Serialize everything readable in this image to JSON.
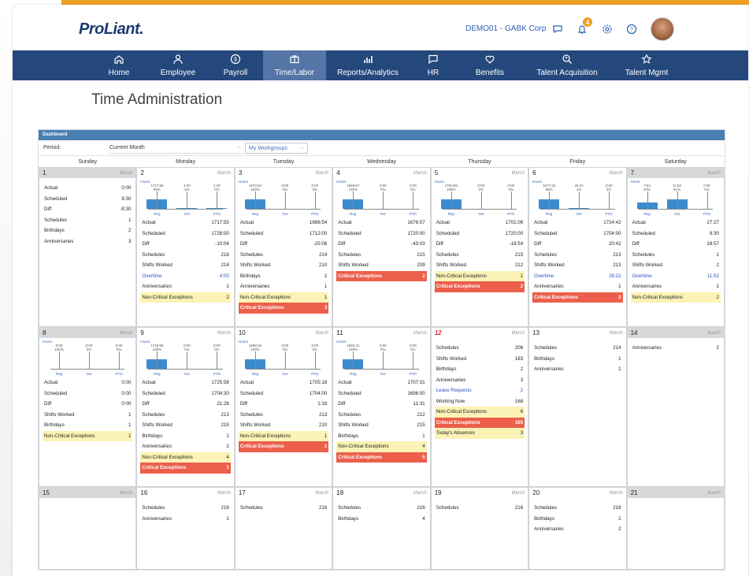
{
  "app": {
    "logo": "ProLiant.",
    "company": "DEMO01 - GABK Corp",
    "notification_count": "4"
  },
  "nav": [
    {
      "label": "Home",
      "icon": "home-icon"
    },
    {
      "label": "Employee",
      "icon": "person-icon"
    },
    {
      "label": "Payroll",
      "icon": "dollar-icon"
    },
    {
      "label": "Time/Labor",
      "icon": "briefcase-icon",
      "active": true
    },
    {
      "label": "Reports/Analytics",
      "icon": "bar-chart-icon"
    },
    {
      "label": "HR",
      "icon": "chat-icon"
    },
    {
      "label": "Benefits",
      "icon": "heart-icon"
    },
    {
      "label": "Talent Acquisition",
      "icon": "search-person-icon"
    },
    {
      "label": "Talent Mgmt",
      "icon": "star-icon"
    }
  ],
  "page": {
    "title": "Time Administration"
  },
  "dashboard": {
    "header": "Dashboard",
    "period_label": "Period:",
    "period_value": "Current Month",
    "workgroups_label": "My Workgroups",
    "days": [
      "Sunday",
      "Monday",
      "Tuesday",
      "Wednesday",
      "Thursday",
      "Friday",
      "Saturday"
    ],
    "chart_labels": {
      "title": "Hours",
      "reg": "Reg",
      "ovt": "Ovt",
      "pto": "PTO"
    }
  },
  "cells": [
    {
      "day": "1",
      "month": "March",
      "weekend": true,
      "rows": [
        [
          "Actual",
          "0:00"
        ],
        [
          "Scheduled",
          "8:30"
        ],
        [
          "Diff",
          "-8:30"
        ],
        [
          "Schedules",
          "1"
        ],
        [
          "Birthdays",
          "2"
        ],
        [
          "Anniversaries",
          "3"
        ]
      ]
    },
    {
      "day": "2",
      "month": "March",
      "chart": {
        "reg": 1717.55,
        "ovt": 4.0,
        "pto": 1.3,
        "reg_label": "1717:55\n99%",
        "ovt_label": "4:00\n0%",
        "pto_label": "1:30\n0%"
      },
      "rows": [
        [
          "Actual",
          "1717:55"
        ],
        [
          "Scheduled",
          "1728:00"
        ],
        [
          "Diff",
          "-10:04"
        ],
        [
          "Schedules",
          "216"
        ],
        [
          "Shifts Worked",
          "214"
        ],
        [
          "Overtime",
          "4:00",
          "ot"
        ],
        [
          "Anniversaries",
          "1"
        ],
        [
          "Non-Critical Exceptions",
          "2",
          "noncrit"
        ]
      ]
    },
    {
      "day": "3",
      "month": "March",
      "chart": {
        "reg": 1686.54,
        "ovt": 0,
        "pto": 0,
        "reg_label": "1673:54\n100%",
        "ovt_label": "0:00\n0%",
        "pto_label": "0:00\n0%"
      },
      "rows": [
        [
          "Actual",
          "1686:54"
        ],
        [
          "Scheduled",
          "1712:00"
        ],
        [
          "Diff",
          "-25:06"
        ],
        [
          "Schedules",
          "214"
        ],
        [
          "Shifts Worked",
          "210"
        ],
        [
          "Birthdays",
          "2"
        ],
        [
          "Anniversaries",
          "1"
        ],
        [
          "Non-Critical Exceptions",
          "1",
          "noncrit"
        ],
        [
          "Critical Exceptions",
          "3",
          "crit"
        ]
      ]
    },
    {
      "day": "4",
      "month": "March",
      "chart": {
        "reg": 1676.57,
        "ovt": 0,
        "pto": 0,
        "reg_label": "1669:57\n100%",
        "ovt_label": "0:00\n0%",
        "pto_label": "0:00\n0%"
      },
      "rows": [
        [
          "Actual",
          "1676:57"
        ],
        [
          "Scheduled",
          "1720:00"
        ],
        [
          "Diff",
          "-43:03"
        ],
        [
          "Schedules",
          "215"
        ],
        [
          "Shifts Worked",
          "209"
        ],
        [
          "Critical Exceptions",
          "2",
          "crit"
        ]
      ]
    },
    {
      "day": "5",
      "month": "March",
      "chart": {
        "reg": 1701.06,
        "ovt": 0,
        "pto": 0,
        "reg_label": "1700:06\n100%",
        "ovt_label": "0:00\n0%",
        "pto_label": "0:00\n0%"
      },
      "rows": [
        [
          "Actual",
          "1701:06"
        ],
        [
          "Scheduled",
          "1720:00"
        ],
        [
          "Diff",
          "-18:54"
        ],
        [
          "Schedules",
          "215"
        ],
        [
          "Shifts Worked",
          "212"
        ],
        [
          "Non-Critical Exceptions",
          "1",
          "noncrit"
        ],
        [
          "Critical Exceptions",
          "2",
          "crit"
        ]
      ]
    },
    {
      "day": "6",
      "month": "March",
      "chart": {
        "reg": 1677.33,
        "ovt": 26.22,
        "pto": 0,
        "reg_label": "1677:33\n98%",
        "ovt_label": "26:22\n1%",
        "pto_label": "0:00\n0%"
      },
      "rows": [
        [
          "Actual",
          "1724:42"
        ],
        [
          "Scheduled",
          "1704:00"
        ],
        [
          "Diff",
          "20:42"
        ],
        [
          "Schedules",
          "213"
        ],
        [
          "Shifts Worked",
          "213"
        ],
        [
          "Overtime",
          "26:22",
          "ot"
        ],
        [
          "Anniversaries",
          "1"
        ],
        [
          "Critical Exceptions",
          "2",
          "crit"
        ]
      ]
    },
    {
      "day": "7",
      "month": "March",
      "weekend": true,
      "chart": {
        "reg": 7.54,
        "ovt": 11.52,
        "pto": 0,
        "reg_label": "7:54\n33%",
        "ovt_label": "11:52\n91%",
        "pto_label": "0:00\n0%"
      },
      "rows": [
        [
          "Actual",
          "27:27"
        ],
        [
          "Scheduled",
          "8:30"
        ],
        [
          "Diff",
          "18:57"
        ],
        [
          "Schedules",
          "1"
        ],
        [
          "Shifts Worked",
          "2"
        ],
        [
          "Overtime",
          "11:52",
          "ot"
        ],
        [
          "Anniversaries",
          "1"
        ],
        [
          "Non-Critical Exceptions",
          "2",
          "noncrit"
        ]
      ]
    },
    {
      "day": "8",
      "month": "March",
      "weekend": true,
      "chart": {
        "reg": 0,
        "ovt": 0,
        "pto": 0,
        "reg_label": "0:00\n100%",
        "ovt_label": "0:00\n0%",
        "pto_label": "0:00\n0%"
      },
      "rows": [
        [
          "Actual",
          "0:00"
        ],
        [
          "Scheduled",
          "0:00"
        ],
        [
          "Diff",
          "0:00"
        ],
        [
          "Shifts Worked",
          "1"
        ],
        [
          "Birthdays",
          "1"
        ],
        [
          "Non-Critical Exceptions",
          "1",
          "noncrit"
        ]
      ]
    },
    {
      "day": "9",
      "month": "March",
      "chart": {
        "reg": 1718.58,
        "ovt": 0,
        "pto": 0,
        "reg_label": "1718:58\n100%",
        "ovt_label": "0:00\n0%",
        "pto_label": "0:00\n0%"
      },
      "rows": [
        [
          "Actual",
          "1725:58"
        ],
        [
          "Scheduled",
          "1704:30"
        ],
        [
          "Diff",
          "21:28"
        ],
        [
          "Schedules",
          "213"
        ],
        [
          "Shifts Worked",
          "215"
        ],
        [
          "Birthdays",
          "1"
        ],
        [
          "Anniversaries",
          "2"
        ],
        [
          "Non-Critical Exceptions",
          "4",
          "noncrit"
        ],
        [
          "Critical Exceptions",
          "1",
          "crit"
        ]
      ]
    },
    {
      "day": "10",
      "month": "March",
      "chart": {
        "reg": 1698.18,
        "ovt": 0,
        "pto": 0,
        "reg_label": "1698:18\n100%",
        "ovt_label": "0:00\n0%",
        "pto_label": "0:00\n0%"
      },
      "rows": [
        [
          "Actual",
          "1705:18"
        ],
        [
          "Scheduled",
          "1704:00"
        ],
        [
          "Diff",
          "1:18"
        ],
        [
          "Schedules",
          "213"
        ],
        [
          "Shifts Worked",
          "210"
        ],
        [
          "Non-Critical Exceptions",
          "1",
          "noncrit"
        ],
        [
          "Critical Exceptions",
          "1",
          "crit"
        ]
      ]
    },
    {
      "day": "11",
      "month": "March",
      "chart": {
        "reg": 1692.31,
        "ovt": 0,
        "pto": 0,
        "reg_label": "1692:31\n100%",
        "ovt_label": "0:00\n0%",
        "pto_label": "0:00\n0%"
      },
      "rows": [
        [
          "Actual",
          "1707:31"
        ],
        [
          "Scheduled",
          "1696:00"
        ],
        [
          "Diff",
          "11:31"
        ],
        [
          "Schedules",
          "212"
        ],
        [
          "Shifts Worked",
          "215"
        ],
        [
          "Birthdays",
          "1"
        ],
        [
          "Non-Critical Exceptions",
          "4",
          "noncrit"
        ],
        [
          "Critical Exceptions",
          "5",
          "crit"
        ]
      ]
    },
    {
      "day": "12",
      "month": "March",
      "today": true,
      "rows": [
        [
          "Schedules",
          "206"
        ],
        [
          "Shifts Worked",
          "183"
        ],
        [
          "Birthdays",
          "2"
        ],
        [
          "Anniversaries",
          "3"
        ],
        [
          "Leave Requests",
          "2",
          "ot"
        ],
        [
          "Working Now",
          "168"
        ],
        [
          "Non-Critical Exceptions",
          "6",
          "noncrit"
        ],
        [
          "Critical Exceptions",
          "165",
          "crit"
        ],
        [
          "Today's Absences",
          "3",
          "noncrit"
        ]
      ]
    },
    {
      "day": "13",
      "month": "March",
      "rows": [
        [
          "Schedules",
          "214"
        ],
        [
          "Birthdays",
          "1"
        ],
        [
          "Anniversaries",
          "1"
        ]
      ]
    },
    {
      "day": "14",
      "month": "March",
      "weekend": true,
      "rows": [
        [
          "Anniversaries",
          "2"
        ]
      ]
    },
    {
      "day": "15",
      "month": "March",
      "weekend": true,
      "rows": []
    },
    {
      "day": "16",
      "month": "March",
      "rows": [
        [
          "Schedules",
          "216"
        ],
        [
          "Anniversaries",
          "1"
        ]
      ]
    },
    {
      "day": "17",
      "month": "March",
      "rows": [
        [
          "Schedules",
          "216"
        ]
      ]
    },
    {
      "day": "18",
      "month": "March",
      "rows": [
        [
          "Schedules",
          "216"
        ],
        [
          "Birthdays",
          "4"
        ]
      ]
    },
    {
      "day": "19",
      "month": "March",
      "rows": [
        [
          "Schedules",
          "216"
        ]
      ]
    },
    {
      "day": "20",
      "month": "March",
      "rows": [
        [
          "Schedules",
          "216"
        ],
        [
          "Birthdays",
          "2"
        ],
        [
          "Anniversaries",
          "2"
        ]
      ]
    },
    {
      "day": "21",
      "month": "March",
      "weekend": true,
      "rows": []
    }
  ]
}
